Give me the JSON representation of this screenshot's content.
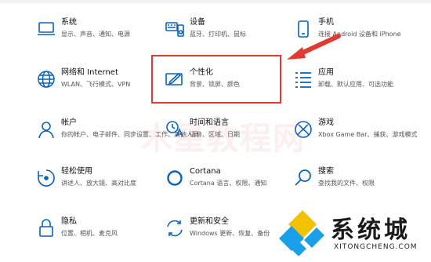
{
  "tiles": [
    {
      "title": "系统",
      "desc": "显示、声音、通知、电源"
    },
    {
      "title": "设备",
      "desc": "蓝牙、打印机、鼠标"
    },
    {
      "title": "手机",
      "desc": "连接 Android 设备和 iPhone"
    },
    {
      "title": "网络和 Internet",
      "desc": "WLAN、飞行模式、VPN"
    },
    {
      "title": "个性化",
      "desc": "背景、锁屏、颜色"
    },
    {
      "title": "应用",
      "desc": "卸载、默认应用、可选功能"
    },
    {
      "title": "帐户",
      "desc": "你的帐户、电子邮件、同步设置、工作、其他人员"
    },
    {
      "title": "时间和语言",
      "desc": "语音、区域、日期"
    },
    {
      "title": "游戏",
      "desc": "Xbox Game Bar、捕获、游戏模式"
    },
    {
      "title": "轻松使用",
      "desc": "讲述人、放大镜、高对比度"
    },
    {
      "title": "Cortana",
      "desc": "Cortana 语言、权限、通知"
    },
    {
      "title": "搜索",
      "desc": "查找我的文件、权限"
    },
    {
      "title": "隐私",
      "desc": "位置、相机、麦克风"
    },
    {
      "title": "更新和安全",
      "desc": "Windows 更新、恢复、备份"
    }
  ],
  "watermark": "木星教程网",
  "brand": {
    "name": "系统城",
    "url": "XITONGCHENG.COM"
  },
  "colors": {
    "icon": "#0a63b8",
    "highlight": "#e03a32"
  }
}
